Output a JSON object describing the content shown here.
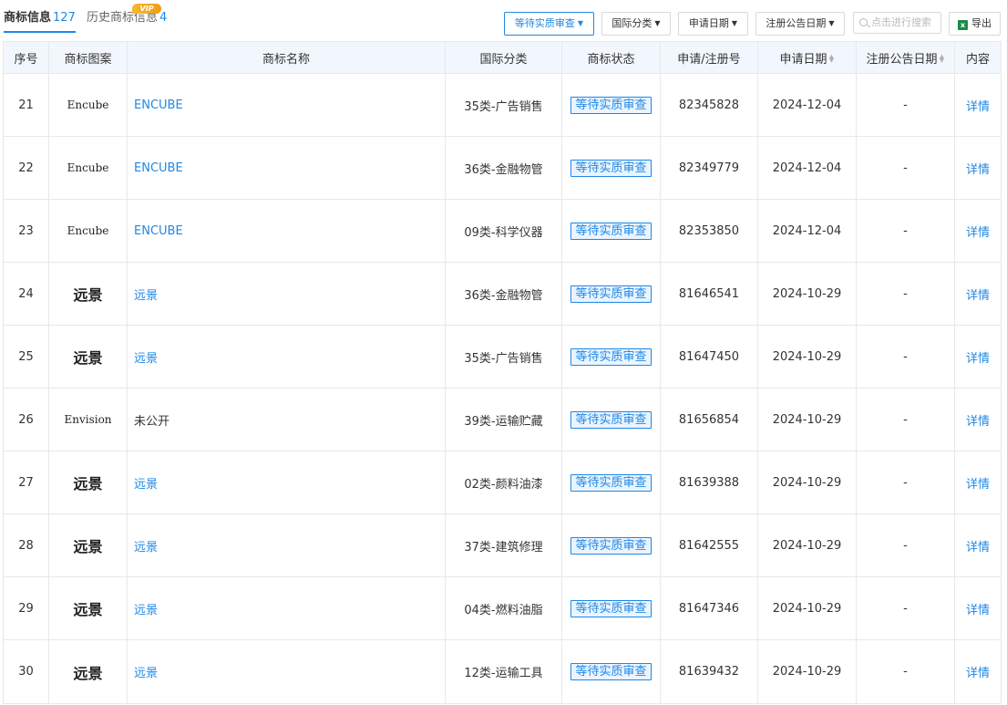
{
  "tabs": {
    "active": {
      "label": "商标信息",
      "count": "127"
    },
    "history": {
      "label": "历史商标信息",
      "count": "4",
      "badge": "VIP"
    }
  },
  "filters": {
    "status": "等待实质审查",
    "class": "国际分类",
    "apply_date": "申请日期",
    "notice_date": "注册公告日期"
  },
  "search": {
    "placeholder": "点击进行搜索"
  },
  "export": {
    "label": "导出",
    "icon": "excel-icon"
  },
  "table": {
    "headers": {
      "index": "序号",
      "logo": "商标图案",
      "name": "商标名称",
      "class": "国际分类",
      "status": "商标状态",
      "regno": "申请/注册号",
      "apply_date": "申请日期",
      "notice_date": "注册公告日期",
      "content": "内容"
    },
    "rows": [
      {
        "index": "21",
        "logo": "Encube",
        "name": "ENCUBE",
        "class": "35类-广告销售",
        "status": "等待实质审查",
        "regno": "82345828",
        "apply_date": "2024-12-04",
        "notice_date": "-",
        "content": "详情"
      },
      {
        "index": "22",
        "logo": "Encube",
        "name": "ENCUBE",
        "class": "36类-金融物管",
        "status": "等待实质审查",
        "regno": "82349779",
        "apply_date": "2024-12-04",
        "notice_date": "-",
        "content": "详情"
      },
      {
        "index": "23",
        "logo": "Encube",
        "name": "ENCUBE",
        "class": "09类-科学仪器",
        "status": "等待实质审查",
        "regno": "82353850",
        "apply_date": "2024-12-04",
        "notice_date": "-",
        "content": "详情"
      },
      {
        "index": "24",
        "logo": "远景",
        "name": "远景",
        "class": "36类-金融物管",
        "status": "等待实质审查",
        "regno": "81646541",
        "apply_date": "2024-10-29",
        "notice_date": "-",
        "content": "详情"
      },
      {
        "index": "25",
        "logo": "远景",
        "name": "远景",
        "class": "35类-广告销售",
        "status": "等待实质审查",
        "regno": "81647450",
        "apply_date": "2024-10-29",
        "notice_date": "-",
        "content": "详情"
      },
      {
        "index": "26",
        "logo": "Envision",
        "name": "未公开",
        "class": "39类-运输贮藏",
        "status": "等待实质审查",
        "regno": "81656854",
        "apply_date": "2024-10-29",
        "notice_date": "-",
        "content": "详情"
      },
      {
        "index": "27",
        "logo": "远景",
        "name": "远景",
        "class": "02类-颜料油漆",
        "status": "等待实质审查",
        "regno": "81639388",
        "apply_date": "2024-10-29",
        "notice_date": "-",
        "content": "详情"
      },
      {
        "index": "28",
        "logo": "远景",
        "name": "远景",
        "class": "37类-建筑修理",
        "status": "等待实质审查",
        "regno": "81642555",
        "apply_date": "2024-10-29",
        "notice_date": "-",
        "content": "详情"
      },
      {
        "index": "29",
        "logo": "远景",
        "name": "远景",
        "class": "04类-燃料油脂",
        "status": "等待实质审查",
        "regno": "81647346",
        "apply_date": "2024-10-29",
        "notice_date": "-",
        "content": "详情"
      },
      {
        "index": "30",
        "logo": "远景",
        "name": "远景",
        "class": "12类-运输工具",
        "status": "等待实质审查",
        "regno": "81639432",
        "apply_date": "2024-10-29",
        "notice_date": "-",
        "content": "详情"
      }
    ]
  },
  "colors": {
    "accent": "#1e88e5",
    "header_bg": "#f2f7fe",
    "vip": "#f39c12"
  }
}
